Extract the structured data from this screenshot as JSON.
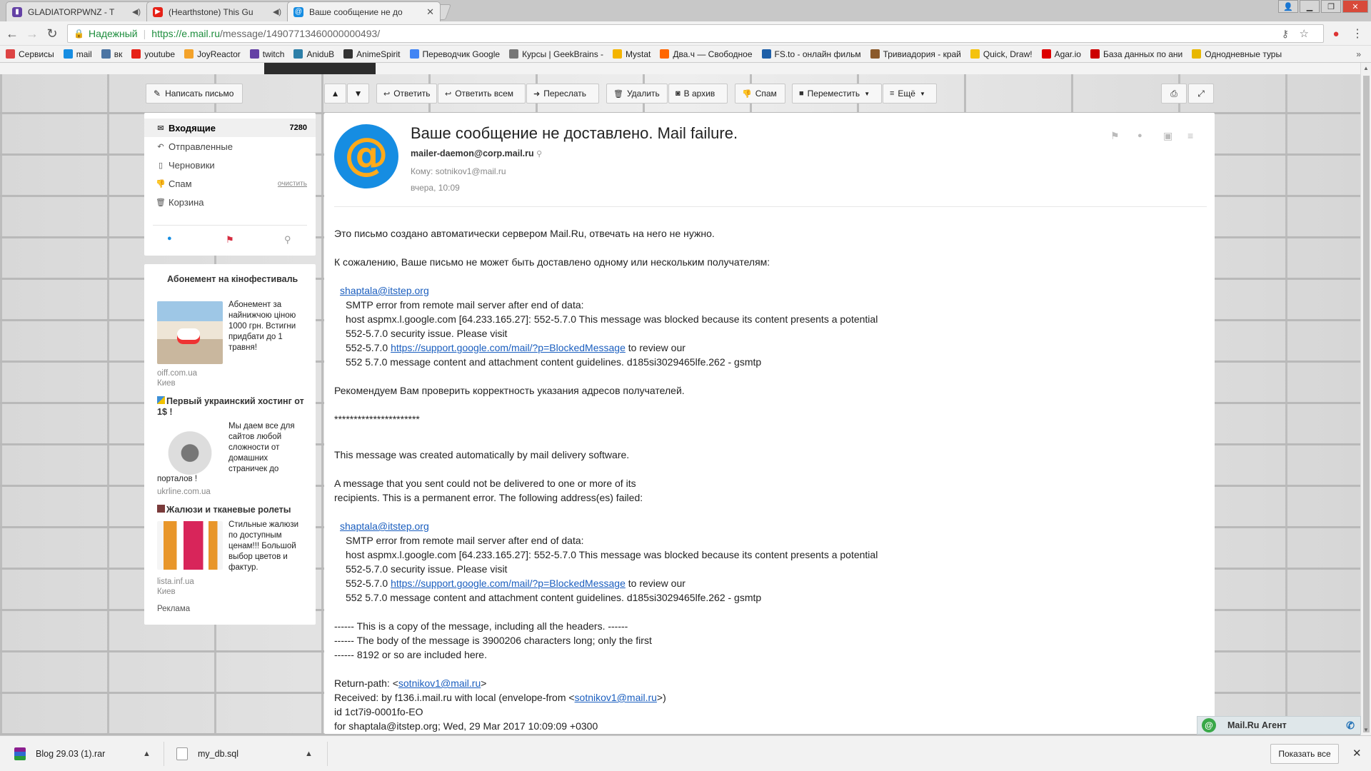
{
  "browser": {
    "tabs": [
      {
        "title": "GLADIATORPWNZ - T",
        "color": "#6441a5",
        "active": false
      },
      {
        "title": "(Hearthstone) This Gu",
        "color": "#e62117",
        "active": false
      },
      {
        "title": "Ваше сообщение не до",
        "color": "#168de2",
        "active": true
      }
    ],
    "address": {
      "secure_label": "Надежный",
      "url_host": "https://e.mail.ru",
      "url_path": "/message/14907713460000000493/"
    },
    "bookmarks": [
      {
        "label": "Сервисы",
        "color": "#d44"
      },
      {
        "label": "mail",
        "color": "#168de2"
      },
      {
        "label": "вк",
        "color": "#4c75a3"
      },
      {
        "label": "youtube",
        "color": "#e62117"
      },
      {
        "label": "JoyReactor",
        "color": "#f3a22a"
      },
      {
        "label": "twitch",
        "color": "#6441a5"
      },
      {
        "label": "AniduB",
        "color": "#2d7fa8"
      },
      {
        "label": "AnimeSpirit",
        "color": "#333"
      },
      {
        "label": "Переводчик Google",
        "color": "#4285f4"
      },
      {
        "label": "Курсы | GeekBrains -",
        "color": "#777"
      },
      {
        "label": "Mystat",
        "color": "#f4b400"
      },
      {
        "label": "Два.ч — Свободное",
        "color": "#f60"
      },
      {
        "label": "FS.to - онлайн фильм",
        "color": "#1e5fa8"
      },
      {
        "label": "Тривиадория - край",
        "color": "#8b5a2b"
      },
      {
        "label": "Quick, Draw!",
        "color": "#f4c20d"
      },
      {
        "label": "Agar.io",
        "color": "#d00"
      },
      {
        "label": "База данных по ани",
        "color": "#c00"
      },
      {
        "label": "Однодневные туры",
        "color": "#e8b700"
      }
    ]
  },
  "toolbar": {
    "compose": "Написать письмо",
    "reply": "Ответить",
    "reply_all": "Ответить всем",
    "forward": "Переслать",
    "delete": "Удалить",
    "archive": "В архив",
    "spam": "Спам",
    "move": "Переместить",
    "more": "Ещё"
  },
  "folders": [
    {
      "label": "Входящие",
      "count": "7280"
    },
    {
      "label": "Отправленные"
    },
    {
      "label": "Черновики"
    },
    {
      "label": "Спам",
      "action": "очистить"
    },
    {
      "label": "Корзина"
    }
  ],
  "ads": [
    {
      "title": "Абонемент на кінофестиваль",
      "text": "Абонемент за найнижчою ціною 1000 грн. Встигни придбати до 1 травня!",
      "source": "oiff.com.ua",
      "city": "Киев"
    },
    {
      "title": "Первый украинский хостинг от 1$ !",
      "text": "Мы даем все для сайтов любой сложности от домашних страничек до",
      "tail": "порталов !",
      "source": "ukrline.com.ua"
    },
    {
      "title": "Жалюзи и тканевые ролеты",
      "text": "Стильные жалюзи по доступным ценам!!! Большой выбор цветов и фактур.",
      "source": "lista.inf.ua",
      "city": "Киев"
    }
  ],
  "ads_label": "Реклама",
  "message": {
    "subject": "Ваше сообщение не доставлено. Mail failure.",
    "from": "mailer-daemon@corp.mail.ru",
    "to": "Кому: sotnikov1@mail.ru",
    "date": "вчера, 10:09",
    "lines": {
      "l1": "Это письмо создано автоматически сервером Mail.Ru, отвечать на него не нужно.",
      "l2": "К сожалению, Ваше письмо не может быть доставлено одному или нескольким получателям:",
      "rcpt": "shaptala@itstep.org",
      "e1": "SMTP error from remote mail server after end of data:",
      "e2": "host aspmx.l.google.com [64.233.165.27]: 552-5.7.0 This message was blocked because its content presents a potential",
      "e3": "552-5.7.0 security issue. Please visit",
      "e4a": "552-5.7.0 ",
      "e4link": "https://support.google.com/mail/?p=BlockedMessage",
      "e4b": " to review our",
      "e5": "552 5.7.0 message content and attachment content guidelines. d185si3029465lfe.262 - gsmtp",
      "l3": "Рекомендуем Вам проверить корректность указания адресов получателей.",
      "stars": "**********************",
      "en1": "This message was created automatically by mail delivery software.",
      "en2": "A message that you sent could not be delivered to one or more of its",
      "en3": "recipients. This is a permanent error. The following address(es) failed:",
      "c1": "------ This is a copy of the message, including all the headers. ------",
      "c2": "------ The body of the message is 3900206 characters long; only the first",
      "c3": "------ 8192 or so are included here.",
      "rp": "Return-path: <",
      "rp_link": "sotnikov1@mail.ru",
      "rp_end": ">",
      "rc": "Received: by f136.i.mail.ru with local (envelope-from <",
      "rc_end": ">)",
      "id": "id 1ct7i9-0001fo-EO",
      "for": "for shaptala@itstep.org; Wed, 29 Mar 2017 10:09:09 +0300"
    }
  },
  "agent": {
    "label": "Mail.Ru Агент"
  },
  "downloads": {
    "items": [
      "Blog 29.03 (1).rar",
      "my_db.sql"
    ],
    "show_all": "Показать все"
  }
}
